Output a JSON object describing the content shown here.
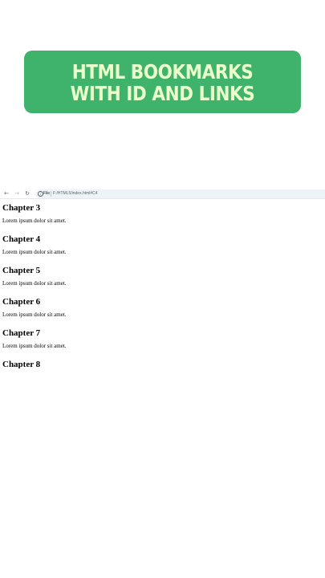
{
  "banner": {
    "title": "HTML BOOKMARKS WITH ID AND LINKS",
    "accent_color": "#3fb36c",
    "text_color": "#eaffc9"
  },
  "browser": {
    "toolbar": {
      "back_icon": "arrow-left-icon",
      "forward_icon": "arrow-right-icon",
      "reload_icon": "reload-icon",
      "info_icon": "info-icon",
      "file_label": "File",
      "url": "F:/HTML5/index.html#C4"
    },
    "page": {
      "chapters": [
        {
          "heading": "Chapter 3",
          "text": "Lorem ipsum dolor sit amet."
        },
        {
          "heading": "Chapter 4",
          "text": "Lorem ipsum dolor sit amet."
        },
        {
          "heading": "Chapter 5",
          "text": "Lorem ipsum dolor sit amet."
        },
        {
          "heading": "Chapter 6",
          "text": "Lorem ipsum dolor sit amet."
        },
        {
          "heading": "Chapter 7",
          "text": "Lorem ipsum dolor sit amet."
        },
        {
          "heading": "Chapter 8",
          "text": ""
        }
      ]
    }
  }
}
